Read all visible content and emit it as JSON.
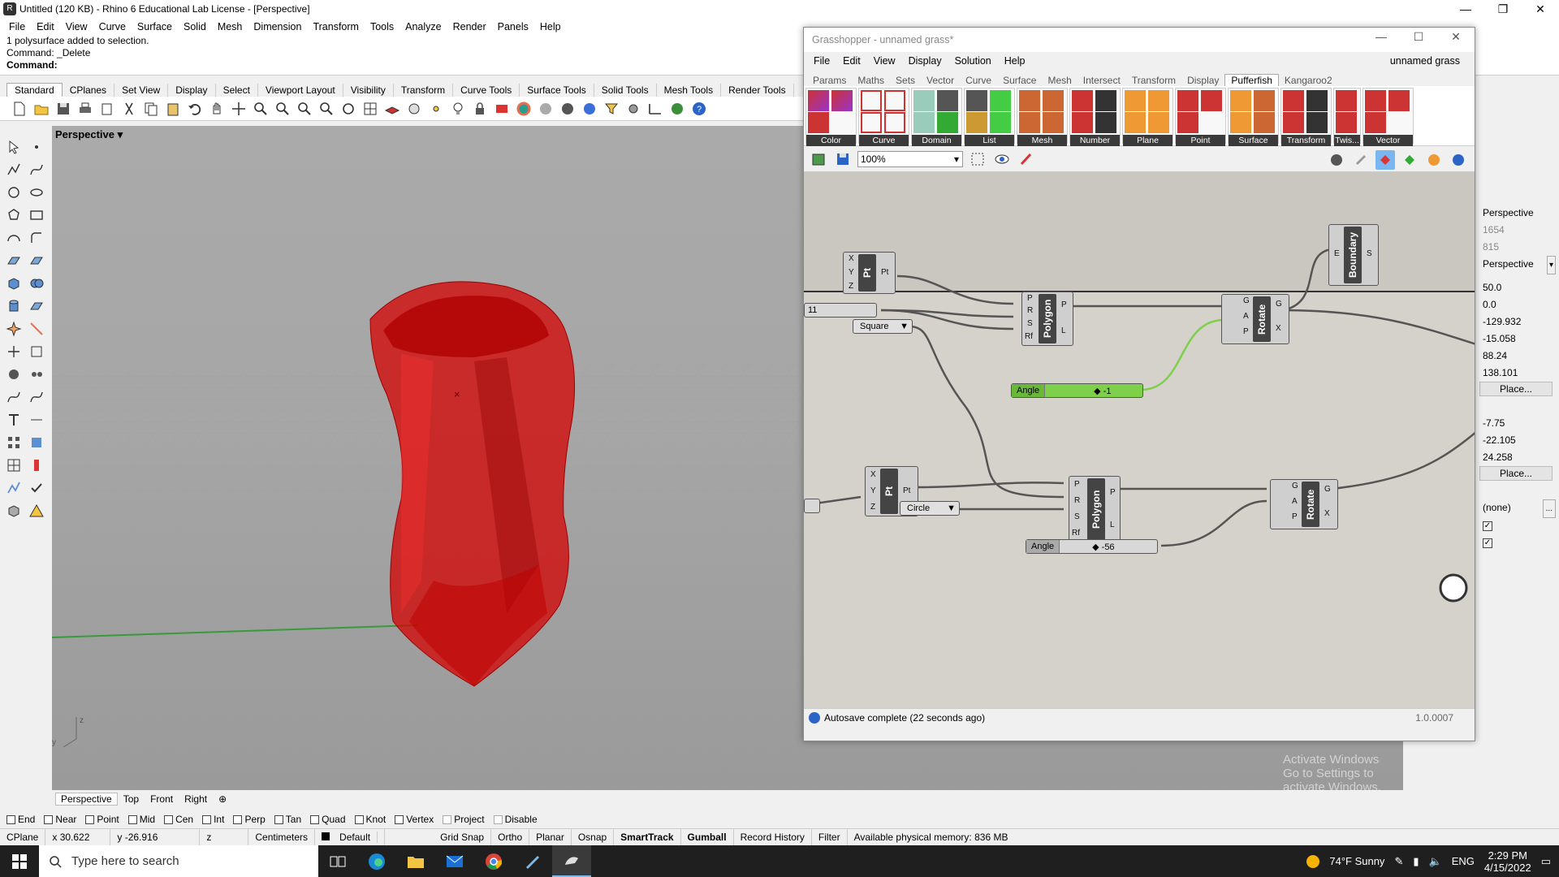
{
  "rhino": {
    "title": "Untitled (120 KB) - Rhino 6 Educational Lab License - [Perspective]",
    "menu": [
      "File",
      "Edit",
      "View",
      "Curve",
      "Surface",
      "Solid",
      "Mesh",
      "Dimension",
      "Transform",
      "Tools",
      "Analyze",
      "Render",
      "Panels",
      "Help"
    ],
    "command_history": [
      "1 polysurface added to selection.",
      "Command: _Delete"
    ],
    "command_label": "Command:",
    "toolbar_tabs": [
      "Standard",
      "CPlanes",
      "Set View",
      "Display",
      "Select",
      "Viewport Layout",
      "Visibility",
      "Transform",
      "Curve Tools",
      "Surface Tools",
      "Solid Tools",
      "Mesh Tools",
      "Render Tools"
    ],
    "viewport_label": "Perspective",
    "viewport_tabs": [
      "Perspective",
      "Top",
      "Front",
      "Right"
    ],
    "osnaps": [
      {
        "label": "End",
        "checked": false
      },
      {
        "label": "Near",
        "checked": false
      },
      {
        "label": "Point",
        "checked": false
      },
      {
        "label": "Mid",
        "checked": false
      },
      {
        "label": "Cen",
        "checked": false
      },
      {
        "label": "Int",
        "checked": false
      },
      {
        "label": "Perp",
        "checked": false
      },
      {
        "label": "Tan",
        "checked": false
      },
      {
        "label": "Quad",
        "checked": false
      },
      {
        "label": "Knot",
        "checked": false
      },
      {
        "label": "Vertex",
        "checked": false
      },
      {
        "label": "Project",
        "checked": false
      },
      {
        "label": "Disable",
        "checked": false
      }
    ],
    "status": {
      "cplane": "CPlane",
      "x": "x 30.622",
      "y": "y -26.916",
      "z": "z",
      "units": "Centimeters",
      "layer": "Default",
      "grid_snap": "Grid Snap",
      "ortho": "Ortho",
      "planar": "Planar",
      "osnap": "Osnap",
      "smarttrack": "SmartTrack",
      "gumball": "Gumball",
      "record_history": "Record History",
      "filter": "Filter",
      "memory": "Available physical memory: 836 MB"
    },
    "properties_panel": {
      "view": "Perspective",
      "width": "1654",
      "height": "815",
      "projection": "Perspective",
      "lens": "50.0",
      "rotation": "0.0",
      "cam_x": "-129.932",
      "cam_y": "-15.058",
      "cam_z": "88.24",
      "cam_dist": "138.101",
      "place_label": "Place...",
      "tgt_x": "-7.75",
      "tgt_y": "-22.105",
      "tgt_z": "24.258",
      "place2_label": "Place...",
      "wallpaper": "(none)",
      "ellipsis": "..."
    },
    "watermark": [
      "Activate Windows",
      "Go to Settings to activate Windows."
    ]
  },
  "grasshopper": {
    "title": "Grasshopper - unnamed grass*",
    "menu": [
      "File",
      "Edit",
      "View",
      "Display",
      "Solution",
      "Help"
    ],
    "doc_name": "unnamed grass",
    "tabs": [
      "Params",
      "Maths",
      "Sets",
      "Vector",
      "Curve",
      "Surface",
      "Mesh",
      "Intersect",
      "Transform",
      "Display",
      "Pufferfish",
      "Kangaroo2"
    ],
    "active_tab": "Pufferfish",
    "ribbon_groups": [
      "Color",
      "Curve",
      "Domain",
      "List",
      "Mesh",
      "Number",
      "Plane",
      "Point",
      "Surface",
      "Transform",
      "Twis...",
      "Vector"
    ],
    "zoom": "100%",
    "status": "Autosave complete (22 seconds ago)",
    "version": "1.0.0007",
    "nodes": {
      "pt1": {
        "label": "Pt",
        "inputs": [
          "X",
          "Y",
          "Z"
        ],
        "output": "Pt"
      },
      "polygon1": {
        "label": "Polygon",
        "inputs": [
          "P",
          "R",
          "S",
          "Rf"
        ],
        "outputs": [
          "P",
          "L"
        ]
      },
      "rotate1": {
        "label": "Rotate",
        "inputs": [
          "G",
          "A",
          "P"
        ],
        "outputs": [
          "G",
          "X"
        ]
      },
      "boundary": {
        "label": "Boundary",
        "input": "E",
        "output": "S"
      },
      "pt2": {
        "label": "Pt",
        "inputs": [
          "X",
          "Y",
          "Z"
        ],
        "output": "Pt"
      },
      "polygon2": {
        "label": "Polygon",
        "inputs": [
          "P",
          "R",
          "S",
          "Rf"
        ],
        "outputs": [
          "P",
          "L"
        ]
      },
      "rotate2": {
        "label": "Rotate",
        "inputs": [
          "G",
          "A",
          "P"
        ],
        "outputs": [
          "G",
          "X"
        ]
      }
    },
    "slider_top_value": "11",
    "dropdown1": "Square",
    "dropdown2": "Circle",
    "angle1": {
      "name": "Angle",
      "value": "-1"
    },
    "angle2": {
      "name": "Angle",
      "value": "-56"
    }
  },
  "taskbar": {
    "search_placeholder": "Type here to search",
    "weather": "74°F  Sunny",
    "lang": "ENG",
    "time": "2:29 PM",
    "date": "4/15/2022"
  }
}
